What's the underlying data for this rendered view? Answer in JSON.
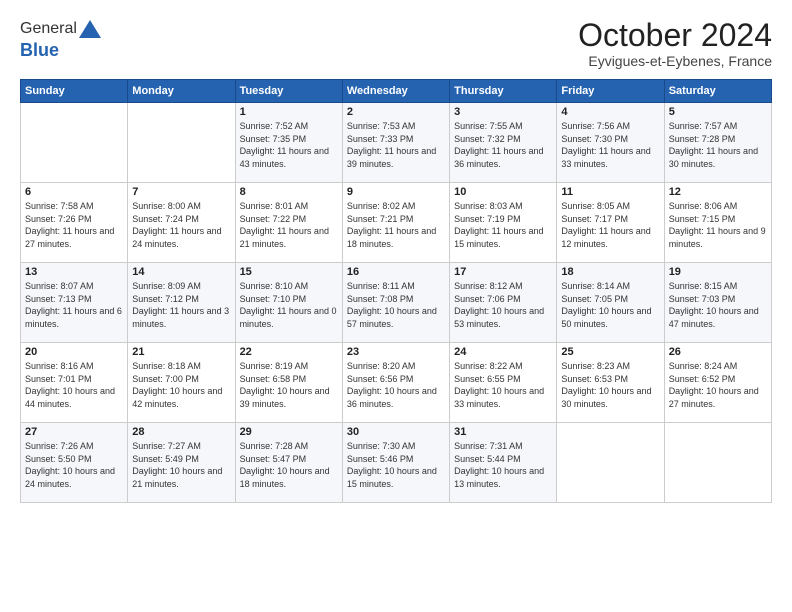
{
  "logo": {
    "general": "General",
    "blue": "Blue"
  },
  "title": "October 2024",
  "location": "Eyvigues-et-Eybenes, France",
  "days_header": [
    "Sunday",
    "Monday",
    "Tuesday",
    "Wednesday",
    "Thursday",
    "Friday",
    "Saturday"
  ],
  "weeks": [
    [
      {
        "day": "",
        "content": ""
      },
      {
        "day": "",
        "content": ""
      },
      {
        "day": "1",
        "content": "Sunrise: 7:52 AM\nSunset: 7:35 PM\nDaylight: 11 hours and 43 minutes."
      },
      {
        "day": "2",
        "content": "Sunrise: 7:53 AM\nSunset: 7:33 PM\nDaylight: 11 hours and 39 minutes."
      },
      {
        "day": "3",
        "content": "Sunrise: 7:55 AM\nSunset: 7:32 PM\nDaylight: 11 hours and 36 minutes."
      },
      {
        "day": "4",
        "content": "Sunrise: 7:56 AM\nSunset: 7:30 PM\nDaylight: 11 hours and 33 minutes."
      },
      {
        "day": "5",
        "content": "Sunrise: 7:57 AM\nSunset: 7:28 PM\nDaylight: 11 hours and 30 minutes."
      }
    ],
    [
      {
        "day": "6",
        "content": "Sunrise: 7:58 AM\nSunset: 7:26 PM\nDaylight: 11 hours and 27 minutes."
      },
      {
        "day": "7",
        "content": "Sunrise: 8:00 AM\nSunset: 7:24 PM\nDaylight: 11 hours and 24 minutes."
      },
      {
        "day": "8",
        "content": "Sunrise: 8:01 AM\nSunset: 7:22 PM\nDaylight: 11 hours and 21 minutes."
      },
      {
        "day": "9",
        "content": "Sunrise: 8:02 AM\nSunset: 7:21 PM\nDaylight: 11 hours and 18 minutes."
      },
      {
        "day": "10",
        "content": "Sunrise: 8:03 AM\nSunset: 7:19 PM\nDaylight: 11 hours and 15 minutes."
      },
      {
        "day": "11",
        "content": "Sunrise: 8:05 AM\nSunset: 7:17 PM\nDaylight: 11 hours and 12 minutes."
      },
      {
        "day": "12",
        "content": "Sunrise: 8:06 AM\nSunset: 7:15 PM\nDaylight: 11 hours and 9 minutes."
      }
    ],
    [
      {
        "day": "13",
        "content": "Sunrise: 8:07 AM\nSunset: 7:13 PM\nDaylight: 11 hours and 6 minutes."
      },
      {
        "day": "14",
        "content": "Sunrise: 8:09 AM\nSunset: 7:12 PM\nDaylight: 11 hours and 3 minutes."
      },
      {
        "day": "15",
        "content": "Sunrise: 8:10 AM\nSunset: 7:10 PM\nDaylight: 11 hours and 0 minutes."
      },
      {
        "day": "16",
        "content": "Sunrise: 8:11 AM\nSunset: 7:08 PM\nDaylight: 10 hours and 57 minutes."
      },
      {
        "day": "17",
        "content": "Sunrise: 8:12 AM\nSunset: 7:06 PM\nDaylight: 10 hours and 53 minutes."
      },
      {
        "day": "18",
        "content": "Sunrise: 8:14 AM\nSunset: 7:05 PM\nDaylight: 10 hours and 50 minutes."
      },
      {
        "day": "19",
        "content": "Sunrise: 8:15 AM\nSunset: 7:03 PM\nDaylight: 10 hours and 47 minutes."
      }
    ],
    [
      {
        "day": "20",
        "content": "Sunrise: 8:16 AM\nSunset: 7:01 PM\nDaylight: 10 hours and 44 minutes."
      },
      {
        "day": "21",
        "content": "Sunrise: 8:18 AM\nSunset: 7:00 PM\nDaylight: 10 hours and 42 minutes."
      },
      {
        "day": "22",
        "content": "Sunrise: 8:19 AM\nSunset: 6:58 PM\nDaylight: 10 hours and 39 minutes."
      },
      {
        "day": "23",
        "content": "Sunrise: 8:20 AM\nSunset: 6:56 PM\nDaylight: 10 hours and 36 minutes."
      },
      {
        "day": "24",
        "content": "Sunrise: 8:22 AM\nSunset: 6:55 PM\nDaylight: 10 hours and 33 minutes."
      },
      {
        "day": "25",
        "content": "Sunrise: 8:23 AM\nSunset: 6:53 PM\nDaylight: 10 hours and 30 minutes."
      },
      {
        "day": "26",
        "content": "Sunrise: 8:24 AM\nSunset: 6:52 PM\nDaylight: 10 hours and 27 minutes."
      }
    ],
    [
      {
        "day": "27",
        "content": "Sunrise: 7:26 AM\nSunset: 5:50 PM\nDaylight: 10 hours and 24 minutes."
      },
      {
        "day": "28",
        "content": "Sunrise: 7:27 AM\nSunset: 5:49 PM\nDaylight: 10 hours and 21 minutes."
      },
      {
        "day": "29",
        "content": "Sunrise: 7:28 AM\nSunset: 5:47 PM\nDaylight: 10 hours and 18 minutes."
      },
      {
        "day": "30",
        "content": "Sunrise: 7:30 AM\nSunset: 5:46 PM\nDaylight: 10 hours and 15 minutes."
      },
      {
        "day": "31",
        "content": "Sunrise: 7:31 AM\nSunset: 5:44 PM\nDaylight: 10 hours and 13 minutes."
      },
      {
        "day": "",
        "content": ""
      },
      {
        "day": "",
        "content": ""
      }
    ]
  ]
}
